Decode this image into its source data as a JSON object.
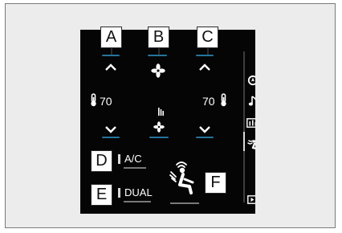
{
  "callouts": {
    "a": "A",
    "b": "B",
    "c": "C",
    "d": "D",
    "e": "E",
    "f": "F"
  },
  "climate": {
    "driver_temp": "70",
    "passenger_temp": "70",
    "ac_label": "A/C",
    "dual_label": "DUAL"
  },
  "side_menu": {
    "icons": [
      "navigation-icon",
      "music-note-icon",
      "energy-monitor-icon",
      "climate-icon",
      "display-icon"
    ]
  },
  "colors": {
    "screen_background": "#050505",
    "indicator_glow": "#2f8fbf",
    "text": "#ffffff"
  }
}
